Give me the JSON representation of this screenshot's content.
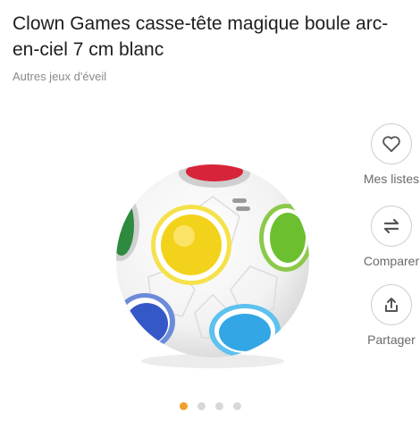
{
  "product": {
    "title": "Clown Games casse-tête magique boule arc-en-ciel 7 cm blanc",
    "category": "Autres jeux d'éveil",
    "image_icon": "rainbow-puzzle-ball-image"
  },
  "actions": [
    {
      "label": "Mes listes",
      "icon": "heart-icon"
    },
    {
      "label": "Comparer",
      "icon": "compare-arrows-icon"
    },
    {
      "label": "Partager",
      "icon": "share-icon"
    }
  ],
  "carousel": {
    "total": 4,
    "active_index": 0,
    "active_color": "#f0a02a",
    "inactive_color": "#d8d8d8"
  }
}
